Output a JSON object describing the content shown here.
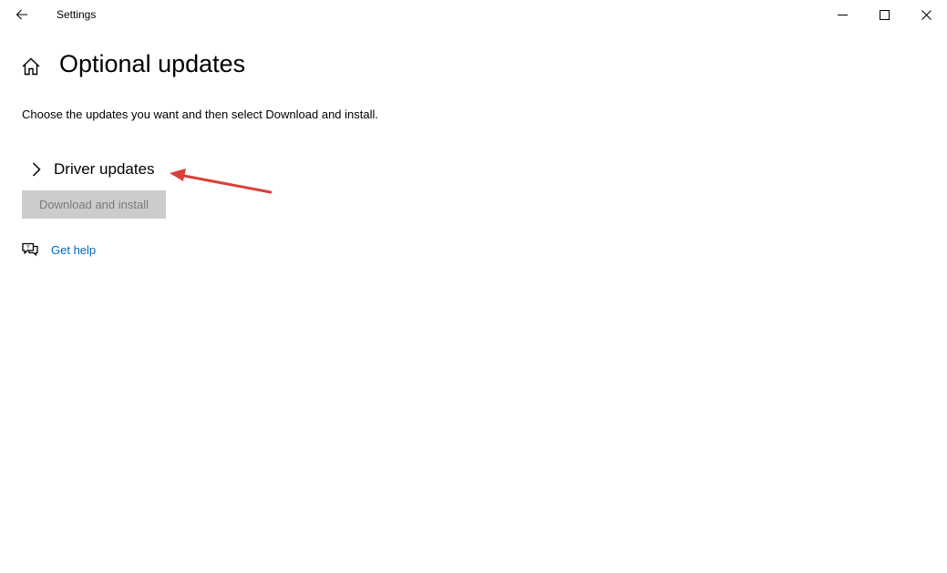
{
  "window": {
    "title": "Settings"
  },
  "titlebar": {
    "back_icon": "back-arrow-icon",
    "minimize_icon": "minimize-icon",
    "maximize_icon": "maximize-icon",
    "close_icon": "close-icon"
  },
  "page": {
    "home_icon": "home-icon",
    "title": "Optional updates",
    "description": "Choose the updates you want and then select Download and install."
  },
  "driver_updates": {
    "icon": "chevron-right-icon",
    "label": "Driver updates",
    "expanded": false
  },
  "download_button": {
    "label": "Download and install",
    "enabled": false
  },
  "help": {
    "icon": "chat-help-icon",
    "label": "Get help"
  },
  "colors": {
    "link": "#0067b8",
    "disabled_button_bg": "#cccccc",
    "disabled_button_text": "#7a7a7a",
    "annotation_arrow": "#d9403a"
  }
}
